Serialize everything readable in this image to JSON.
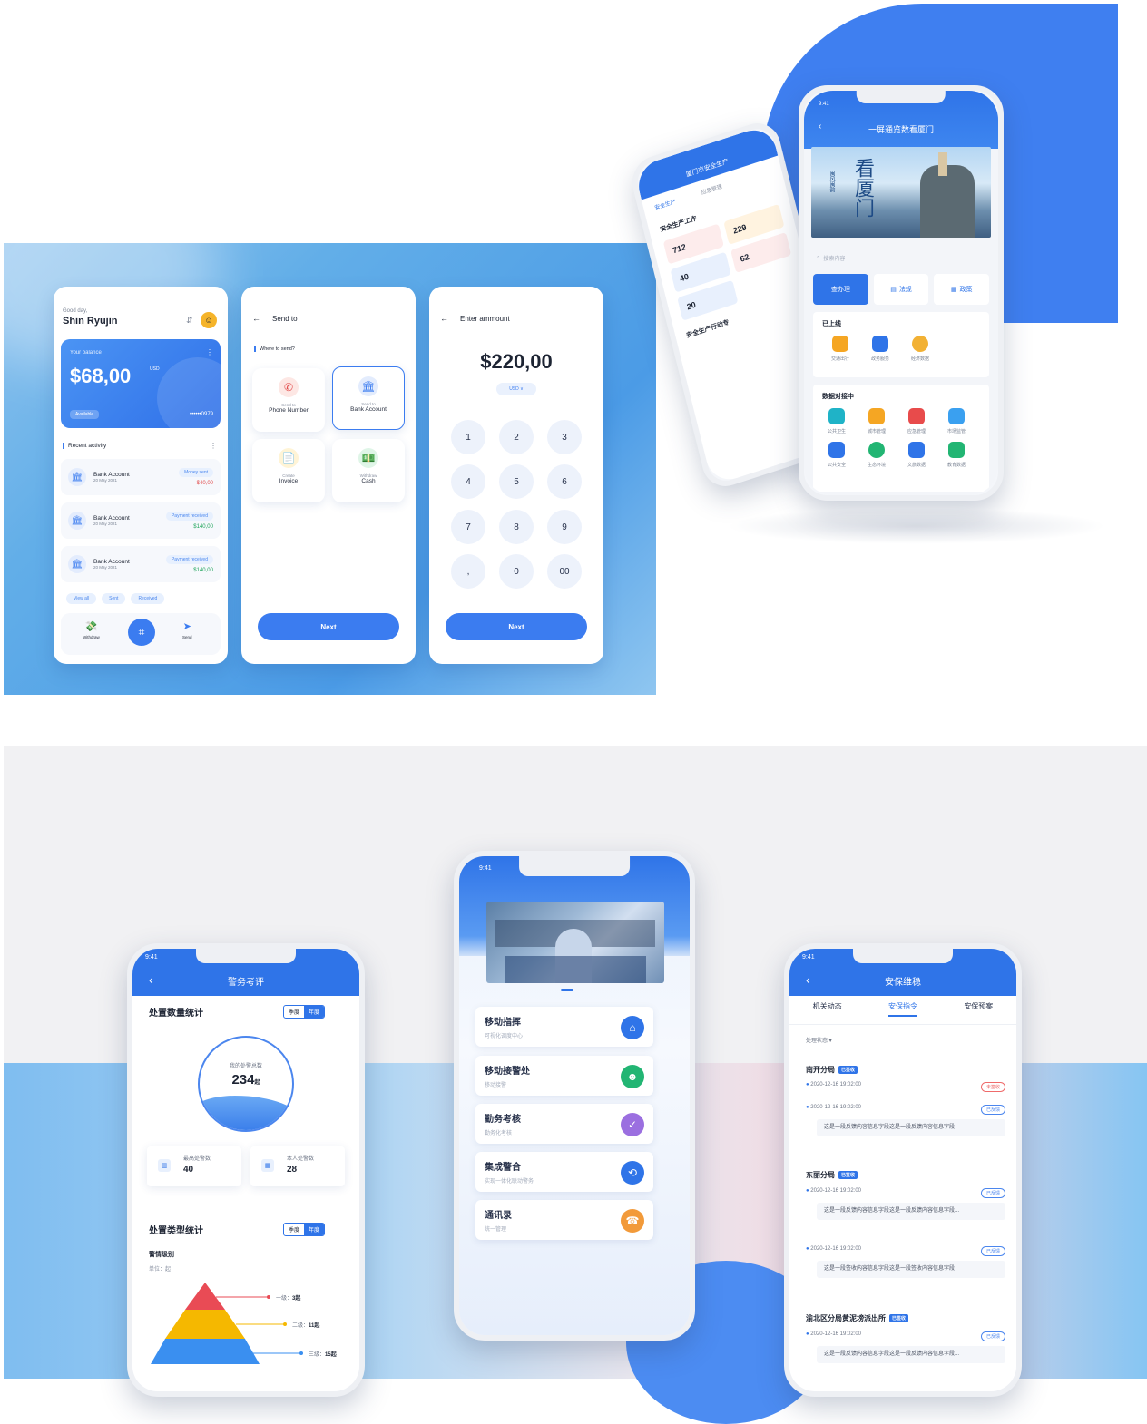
{
  "wallet": {
    "home": {
      "greeting": "Good day,",
      "user_name": "Shin Ryujin",
      "balance_label": "Your balance",
      "balance_amount": "$68,00",
      "currency": "USD",
      "card_number": "••••••0979",
      "card_tag": "Available",
      "recent_title": "Recent activity",
      "activities": [
        {
          "name": "Bank Account",
          "date": "20 May 2021",
          "badge": "Money sent",
          "amount": "-$40,00"
        },
        {
          "name": "Bank Account",
          "date": "20 May 2021",
          "badge": "Payment received",
          "amount": "$140,00"
        },
        {
          "name": "Bank Account",
          "date": "20 May 2021",
          "badge": "Payment received",
          "amount": "$140,00"
        }
      ],
      "filters": [
        "View all",
        "Sent",
        "Received"
      ],
      "nav": {
        "withdraw": "Withdraw",
        "send": "Send"
      }
    },
    "send_to": {
      "title": "Send to",
      "question": "Where to send?",
      "options": [
        {
          "sub": "Send to",
          "label": "Phone Number"
        },
        {
          "sub": "Send to",
          "label": "Bank Account"
        },
        {
          "sub": "Create",
          "label": "Invoice"
        },
        {
          "sub": "Withdraw",
          "label": "Cash"
        }
      ],
      "next": "Next"
    },
    "amount": {
      "title": "Enter ammount",
      "value": "$220,00",
      "currency": "USD ∨",
      "keys": [
        "1",
        "2",
        "3",
        "4",
        "5",
        "6",
        "7",
        "8",
        "9",
        ",",
        "0",
        "00"
      ],
      "next": "Next"
    }
  },
  "gov": {
    "back_phone": {
      "header": "厦门市安全生产",
      "tabs": [
        "安全生产",
        "应急管理"
      ],
      "section": "安全生产工作",
      "stats": [
        "712",
        "229",
        "40",
        "62",
        "20"
      ],
      "footer_title": "安全生产行动专"
    },
    "front_phone": {
      "time": "9:41",
      "title": "一屏通览数看厦门",
      "banner_text": "看厦门",
      "banner_sub": "闽风闽韵",
      "search": "搜索内容",
      "tabs": [
        "查办理",
        "法规",
        "政策"
      ],
      "section1": "已上线",
      "apps1": [
        "交通出行",
        "政务服务",
        "经济数据"
      ],
      "section2": "数据对接中",
      "apps2": [
        "公共卫生",
        "城市管理",
        "应急管理",
        "市场监管",
        "公共安全",
        "生态环境",
        "文旅数据",
        "教育数据"
      ]
    }
  },
  "police": {
    "left_phone": {
      "time": "9:41",
      "title": "警务考评",
      "section1": "处置数量统计",
      "toggle": [
        "季度",
        "年度"
      ],
      "circle_label": "我的处警总数",
      "circle_value": "234",
      "circle_unit": "起",
      "stat1_label": "最高处警数",
      "stat1_value": "40",
      "stat2_label": "本人处警数",
      "stat2_value": "28",
      "section2": "处置类型统计",
      "subtitle": "警情级别",
      "unit": "单位：起",
      "levels": [
        {
          "label": "一级",
          "value": "3起"
        },
        {
          "label": "二级",
          "value": "11起"
        },
        {
          "label": "三级",
          "value": "15起"
        }
      ]
    },
    "center_phone": {
      "time": "9:41",
      "items": [
        {
          "title": "移动指挥",
          "sub": "可视化调度中心",
          "color": "#2f74e8"
        },
        {
          "title": "移动接警处",
          "sub": "移动接警",
          "color": "#22b573"
        },
        {
          "title": "勤务考核",
          "sub": "勤务化考核",
          "color": "#9b6fe0"
        },
        {
          "title": "集成警合",
          "sub": "实现一体化联动警务",
          "color": "#2f74e8"
        },
        {
          "title": "通讯录",
          "sub": "统一管理",
          "color": "#f29a3a"
        }
      ]
    },
    "right_phone": {
      "time": "9:41",
      "title": "安保维稳",
      "tabs": [
        "机关动态",
        "安保指令",
        "安保预案"
      ],
      "filter": "处理状态 ▾",
      "groups": [
        {
          "name": "南开分局",
          "tag": "已签收",
          "entries": [
            {
              "time": "2020-12-16 19:02:00",
              "status": "未签收",
              "status_type": "red"
            },
            {
              "time": "2020-12-16 19:02:00",
              "status": "已反馈",
              "status_type": "blue",
              "content": "这是一段反馈内容信息字段这是一段反馈内容信息字段"
            }
          ]
        },
        {
          "name": "东丽分局",
          "tag": "已签收",
          "entries": [
            {
              "time": "2020-12-16 19:02:00",
              "status": "已反馈",
              "status_type": "blue",
              "content": "这是一段反馈内容信息字段这是一段反馈内容信息字段..."
            },
            {
              "time": "2020-12-16 19:02:00",
              "status": "已反馈",
              "status_type": "blue",
              "content": "这是一段签收内容信息字段这是一段签收内容信息字段"
            }
          ]
        },
        {
          "name": "渝北区分局黄泥塝派出所",
          "tag": "已签收",
          "entries": [
            {
              "time": "2020-12-16 19:02:00",
              "status": "已反馈",
              "status_type": "blue",
              "content": "这是一段反馈内容信息字段这是一段反馈内容信息字段..."
            }
          ]
        }
      ]
    }
  }
}
